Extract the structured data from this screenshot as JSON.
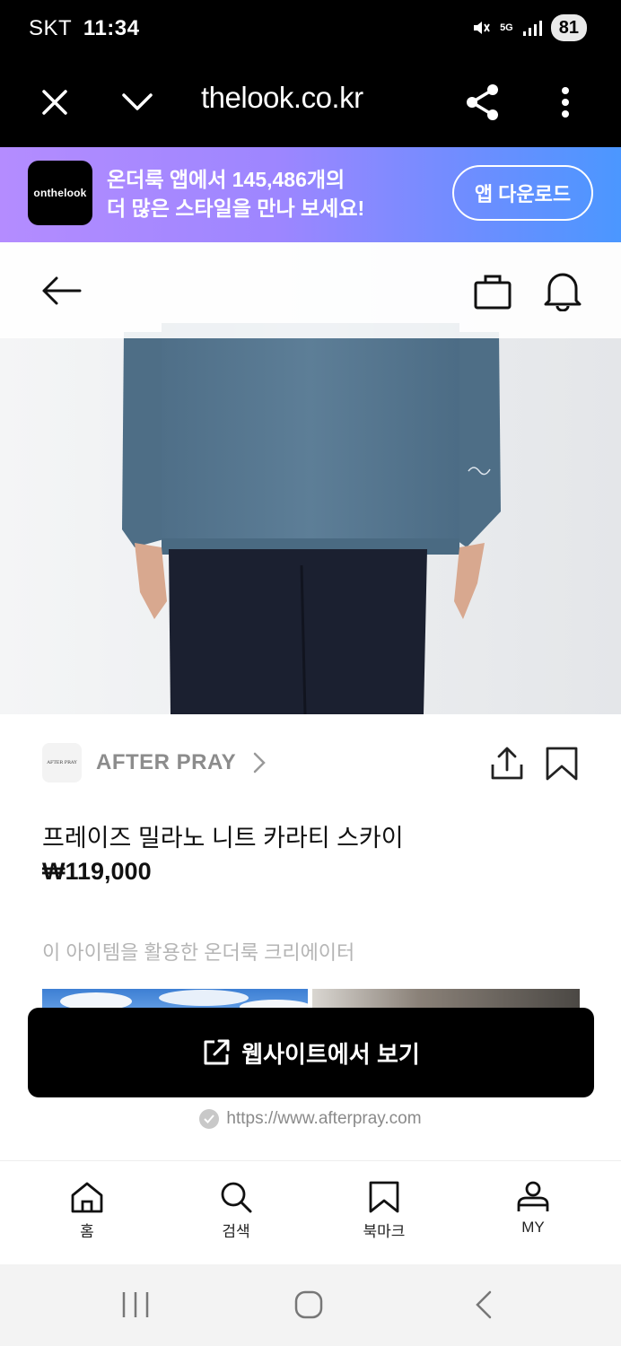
{
  "status_bar": {
    "carrier": "SKT",
    "time": "11:34",
    "network": "5G",
    "battery": "81"
  },
  "browser": {
    "url": "thelook.co.kr",
    "icons": [
      "close-icon",
      "chevron-down-icon",
      "share-icon",
      "more-vert-icon"
    ]
  },
  "app_banner": {
    "logo_text": "onthelook",
    "line1": "온더룩 앱에서 145,486개의",
    "line2": "더 많은 스타일을 만나 보세요!",
    "button_label": "앱 다운로드"
  },
  "top_nav": {
    "icons": [
      "back-arrow-icon",
      "shopping-bag-icon",
      "bell-icon"
    ]
  },
  "brand": {
    "logo_text": "AFTER PRAY",
    "name": "AFTER PRAY"
  },
  "product": {
    "name": "프레이즈 밀라노 니트 카라티 스카이",
    "price": "₩119,000"
  },
  "creators": {
    "heading": "이 아이템을 활용한 온더룩 크리에이터"
  },
  "cta": {
    "label": "웹사이트에서 보기",
    "url": "https://www.afterpray.com"
  },
  "tabbar": {
    "items": [
      {
        "label": "홈",
        "icon": "home-icon"
      },
      {
        "label": "검색",
        "icon": "search-icon"
      },
      {
        "label": "북마크",
        "icon": "bookmark-icon"
      },
      {
        "label": "MY",
        "icon": "user-icon"
      }
    ]
  },
  "colors": {
    "banner_start": "#b48cff",
    "banner_end": "#4b97ff",
    "cta_bg": "#000000",
    "sweater": "#587891",
    "pants": "#1a2030"
  }
}
